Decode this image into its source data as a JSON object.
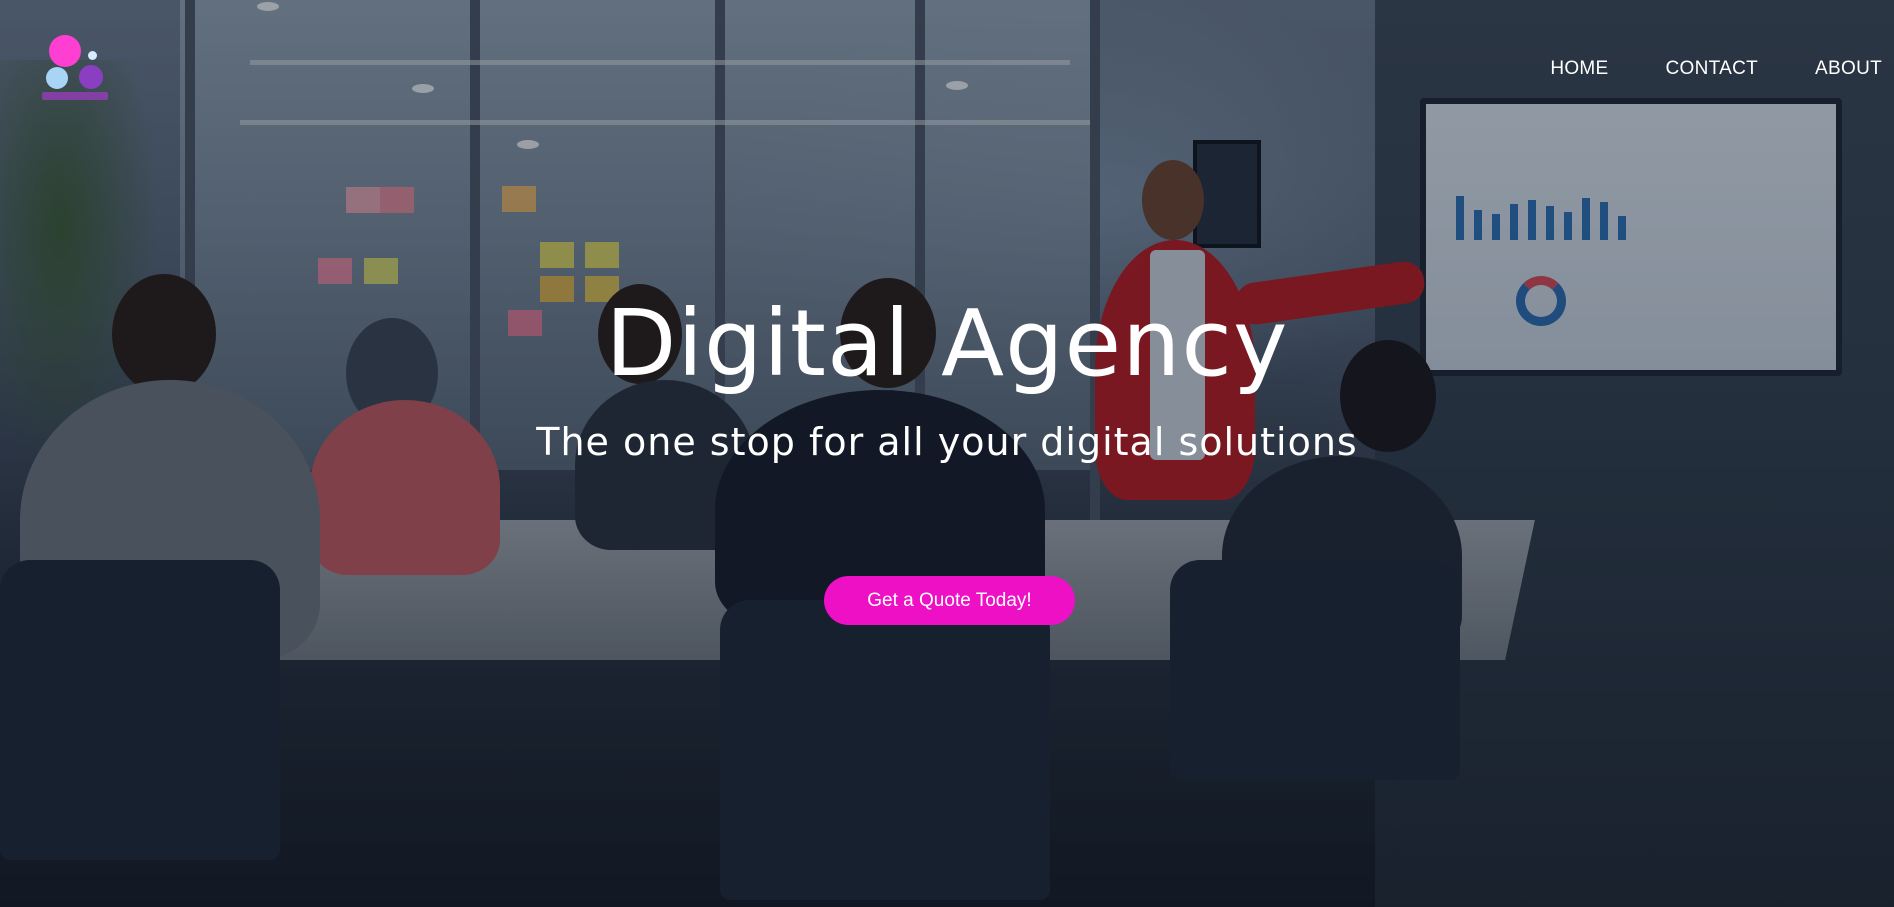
{
  "nav": {
    "items": [
      {
        "label": "HOME"
      },
      {
        "label": "CONTACT"
      },
      {
        "label": "ABOUT"
      }
    ]
  },
  "hero": {
    "title": "Digital Agency",
    "subtitle": "The one stop for all your digital solutions",
    "cta_label": "Get a Quote Today!",
    "background_image": "office-meeting-photo"
  },
  "colors": {
    "accent": "#ee10c4",
    "logo_pink": "#ff3fd2",
    "logo_purple": "#8a3fc3",
    "logo_light_blue": "#a8d4f5",
    "text": "#ffffff"
  },
  "logo": {
    "icon": "dots-logo-icon"
  }
}
